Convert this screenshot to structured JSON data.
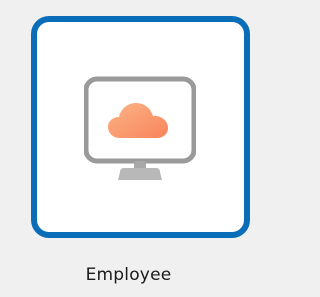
{
  "app": {
    "tile_label": "Employee",
    "icon": "cloud-monitor-icon",
    "colors": {
      "selection_border": "#0a6db7",
      "monitor_gray": "#9a9a9a",
      "cloud_orange": "#f9845b",
      "cloud_peach": "#fbb487",
      "background": "#f0f0f0"
    }
  }
}
